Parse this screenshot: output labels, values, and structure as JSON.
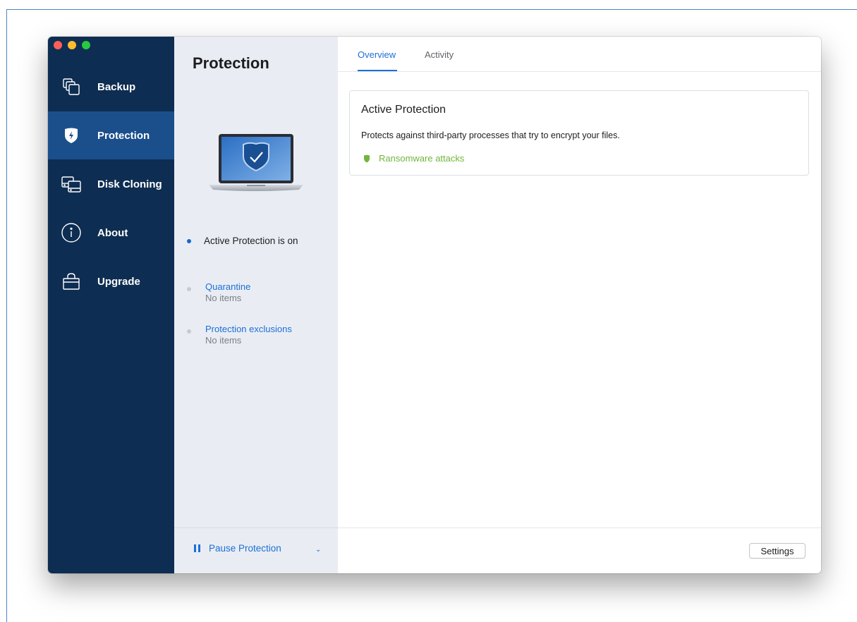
{
  "nav": {
    "items": [
      {
        "label": "Backup",
        "icon": "backup-copy-icon"
      },
      {
        "label": "Protection",
        "icon": "shield-icon"
      },
      {
        "label": "Disk Cloning",
        "icon": "disk-cloning-icon"
      },
      {
        "label": "About",
        "icon": "info-icon"
      },
      {
        "label": "Upgrade",
        "icon": "shopping-bag-icon"
      }
    ],
    "active": "Protection"
  },
  "middle": {
    "title": "Protection",
    "status": "Active Protection is on",
    "quarantine": {
      "label": "Quarantine",
      "sub": "No items"
    },
    "exclusions": {
      "label": "Protection exclusions",
      "sub": "No items"
    },
    "pause_label": "Pause Protection"
  },
  "tabs": [
    {
      "label": "Overview"
    },
    {
      "label": "Activity"
    }
  ],
  "active_tab": "Overview",
  "card": {
    "title": "Active Protection",
    "description": "Protects against third-party processes that try to encrypt your files.",
    "feature": "Ransomware attacks"
  },
  "footer": {
    "settings_label": "Settings"
  },
  "colors": {
    "sidebar": "#0e2d52",
    "sidebar_active": "#1b4f8c",
    "middle_pane": "#e9edf3",
    "accent": "#1c6fd6",
    "feature_green": "#72b53e"
  }
}
